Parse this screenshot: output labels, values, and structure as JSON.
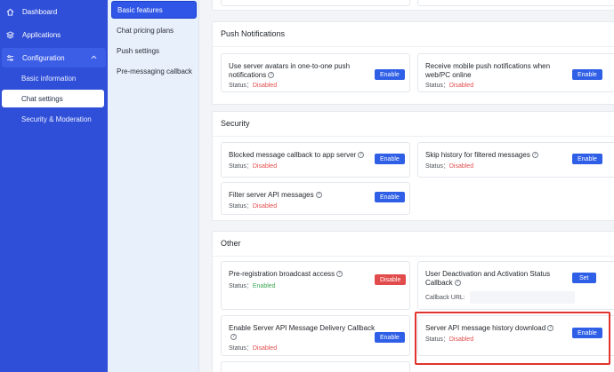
{
  "nav": {
    "dashboard": "Dashboard",
    "applications": "Applications",
    "configuration": "Configuration",
    "sub": [
      "Basic information",
      "Chat settings",
      "Security & Moderation"
    ]
  },
  "subnav": [
    "Basic features",
    "Chat pricing plans",
    "Push settings",
    "Pre-messaging callback"
  ],
  "sections": {
    "push": {
      "title": "Push Notifications",
      "cards": [
        {
          "title": "Use server avatars in one-to-one push notifications",
          "status_label": "Status：",
          "status": "Disabled",
          "button": "Enable"
        },
        {
          "title": "Receive mobile push notifications when web/PC online",
          "status_label": "Status：",
          "status": "Disabled",
          "button": "Enable"
        }
      ]
    },
    "security": {
      "title": "Security",
      "cards": [
        {
          "title": "Blocked message callback to app server",
          "status_label": "Status：",
          "status": "Disabled",
          "button": "Enable"
        },
        {
          "title": "Skip history for filtered messages",
          "status_label": "Status：",
          "status": "Disabled",
          "button": "Enable"
        },
        {
          "title": "Filter server API messages",
          "status_label": "Status：",
          "status": "Disabled",
          "button": "Enable"
        }
      ]
    },
    "other": {
      "title": "Other",
      "cards": [
        {
          "title": "Pre-registration broadcast access",
          "status_label": "Status：",
          "status": "Enabled",
          "button": "Disable"
        },
        {
          "title": "User Deactivation and Activation Status Callback",
          "url_label": "Callback URL:",
          "url_value": "",
          "button": "Set"
        },
        {
          "title": "Enable Server API Message Delivery Callback",
          "status_label": "Status：",
          "status": "Disabled",
          "button": "Enable"
        },
        {
          "title": "Server API message history download",
          "status_label": "Status：",
          "status": "Disabled",
          "button": "Enable"
        }
      ]
    }
  },
  "colors": {
    "primary": "#2f4fd8",
    "button": "#2f5fe6",
    "disabled": "#e34d4d",
    "enabled": "#3aa655",
    "highlight": "#e0342f"
  }
}
